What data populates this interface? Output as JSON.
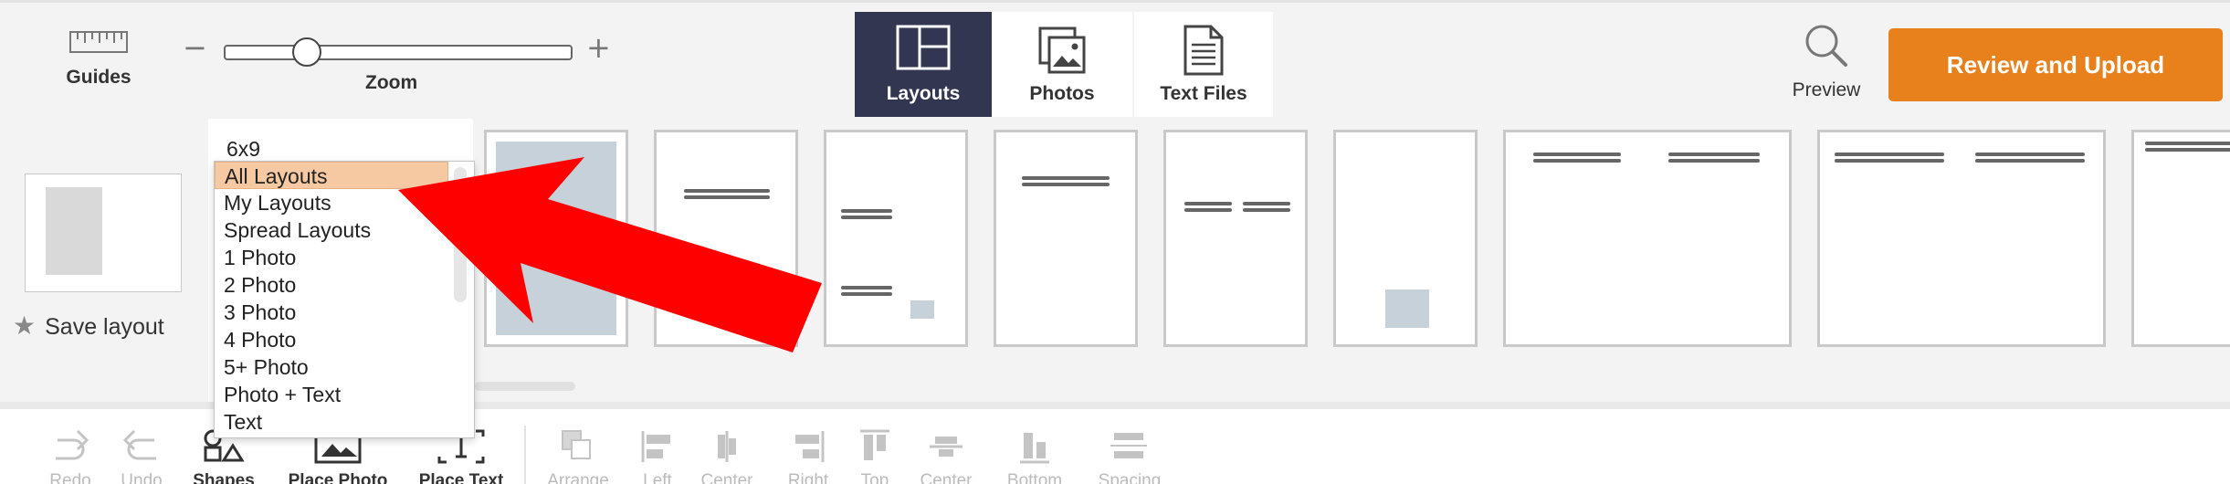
{
  "toolbar": {
    "guides_label": "Guides",
    "zoom_label": "Zoom",
    "zoom_minus": "−",
    "zoom_plus": "+",
    "zoom_level": 0.13,
    "tabs": [
      {
        "label": "Layouts",
        "icon": "layout-grid-icon",
        "active": true
      },
      {
        "label": "Photos",
        "icon": "photos-stack-icon",
        "active": false
      },
      {
        "label": "Text Files",
        "icon": "text-file-icon",
        "active": false
      }
    ],
    "preview_label": "Preview",
    "review_button": "Review and Upload"
  },
  "layouts_panel": {
    "size": "6x9",
    "save_layout_label": "Save layout",
    "dropdown": {
      "selected": "All Layouts",
      "options": [
        "All Layouts",
        "My Layouts",
        "Spread Layouts",
        "1 Photo",
        "2 Photo",
        "3 Photo",
        "4 Photo",
        "5+ Photo",
        "Photo + Text",
        "Text"
      ]
    }
  },
  "bottom_toolbar": {
    "tools": [
      {
        "label": "Redo",
        "enabled": false
      },
      {
        "label": "Undo",
        "enabled": false
      },
      {
        "label": "Shapes",
        "enabled": true
      },
      {
        "label": "Place Photo",
        "enabled": true
      },
      {
        "label": "Place Text",
        "enabled": true
      },
      {
        "label": "Arrange",
        "enabled": false
      },
      {
        "label": "Left",
        "enabled": false
      },
      {
        "label": "Center",
        "enabled": false
      },
      {
        "label": "Right",
        "enabled": false
      },
      {
        "label": "Top",
        "enabled": false
      },
      {
        "label": "Center",
        "enabled": false
      },
      {
        "label": "Bottom",
        "enabled": false
      },
      {
        "label": "Spacing",
        "enabled": false
      }
    ]
  },
  "colors": {
    "accent_orange": "#e8801c",
    "active_tab": "#323650",
    "selected_option": "#f7c9a2",
    "annotation_arrow": "#ff0000"
  }
}
